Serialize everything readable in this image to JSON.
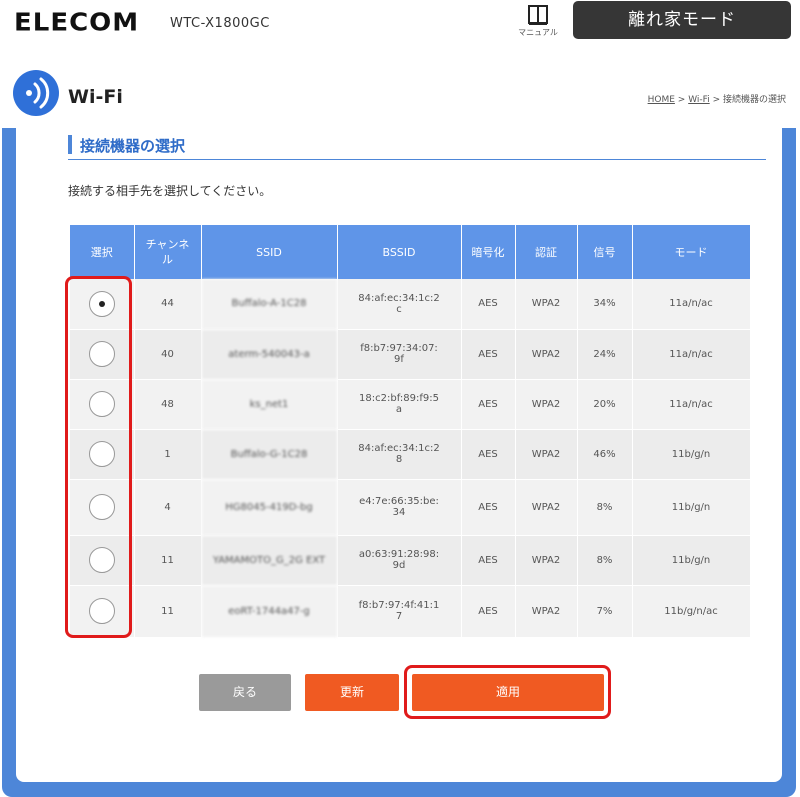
{
  "header": {
    "logo": "ELECOM",
    "model": "WTC-X1800GC",
    "manual_label": "マニュアル",
    "mode_button": "離れ家モード"
  },
  "page": {
    "title": "Wi-Fi",
    "breadcrumb": {
      "home": "HOME",
      "wifi": "Wi-Fi",
      "sep": ">",
      "current": "接続機器の選択"
    }
  },
  "section": {
    "title": "接続機器の選択",
    "instruction": "接続する相手先を選択してください。"
  },
  "table": {
    "headers": {
      "select": "選択",
      "channel_line1": "チャンネ",
      "channel_line2": "ル",
      "ssid": "SSID",
      "bssid": "BSSID",
      "encryption": "暗号化",
      "auth": "認証",
      "signal": "信号",
      "mode": "モード"
    },
    "rows": [
      {
        "selected": true,
        "channel": "44",
        "ssid": "Buffalo-A-1C28",
        "bssid_l1": "84:af:ec:34:1c:2",
        "bssid_l2": "c",
        "enc": "AES",
        "auth": "WPA2",
        "signal": "34%",
        "mode": "11a/n/ac"
      },
      {
        "selected": false,
        "channel": "40",
        "ssid": "aterm-540043-a",
        "bssid_l1": "f8:b7:97:34:07:",
        "bssid_l2": "9f",
        "enc": "AES",
        "auth": "WPA2",
        "signal": "24%",
        "mode": "11a/n/ac"
      },
      {
        "selected": false,
        "channel": "48",
        "ssid": "ks_net1",
        "bssid_l1": "18:c2:bf:89:f9:5",
        "bssid_l2": "a",
        "enc": "AES",
        "auth": "WPA2",
        "signal": "20%",
        "mode": "11a/n/ac"
      },
      {
        "selected": false,
        "channel": "1",
        "ssid": "Buffalo-G-1C28",
        "bssid_l1": "84:af:ec:34:1c:2",
        "bssid_l2": "8",
        "enc": "AES",
        "auth": "WPA2",
        "signal": "46%",
        "mode": "11b/g/n"
      },
      {
        "selected": false,
        "channel": "4",
        "ssid": "HG8045-419D-bg",
        "bssid_l1": "e4:7e:66:35:be:",
        "bssid_l2": "34",
        "enc": "AES",
        "auth": "WPA2",
        "signal": "8%",
        "mode": "11b/g/n"
      },
      {
        "selected": false,
        "channel": "11",
        "ssid": "YAMAMOTO_G_2G EXT",
        "bssid_l1": "a0:63:91:28:98:",
        "bssid_l2": "9d",
        "enc": "AES",
        "auth": "WPA2",
        "signal": "8%",
        "mode": "11b/g/n"
      },
      {
        "selected": false,
        "channel": "11",
        "ssid": "eoRT-1744a47-g",
        "bssid_l1": "f8:b7:97:4f:41:1",
        "bssid_l2": "7",
        "enc": "AES",
        "auth": "WPA2",
        "signal": "7%",
        "mode": "11b/g/n/ac"
      }
    ]
  },
  "buttons": {
    "back": "戻る",
    "refresh": "更新",
    "apply": "適用"
  },
  "colors": {
    "accent_blue": "#4d86d8",
    "header_blue": "#5f95e8",
    "orange": "#f05a22",
    "highlight_red": "#e01b1b"
  }
}
